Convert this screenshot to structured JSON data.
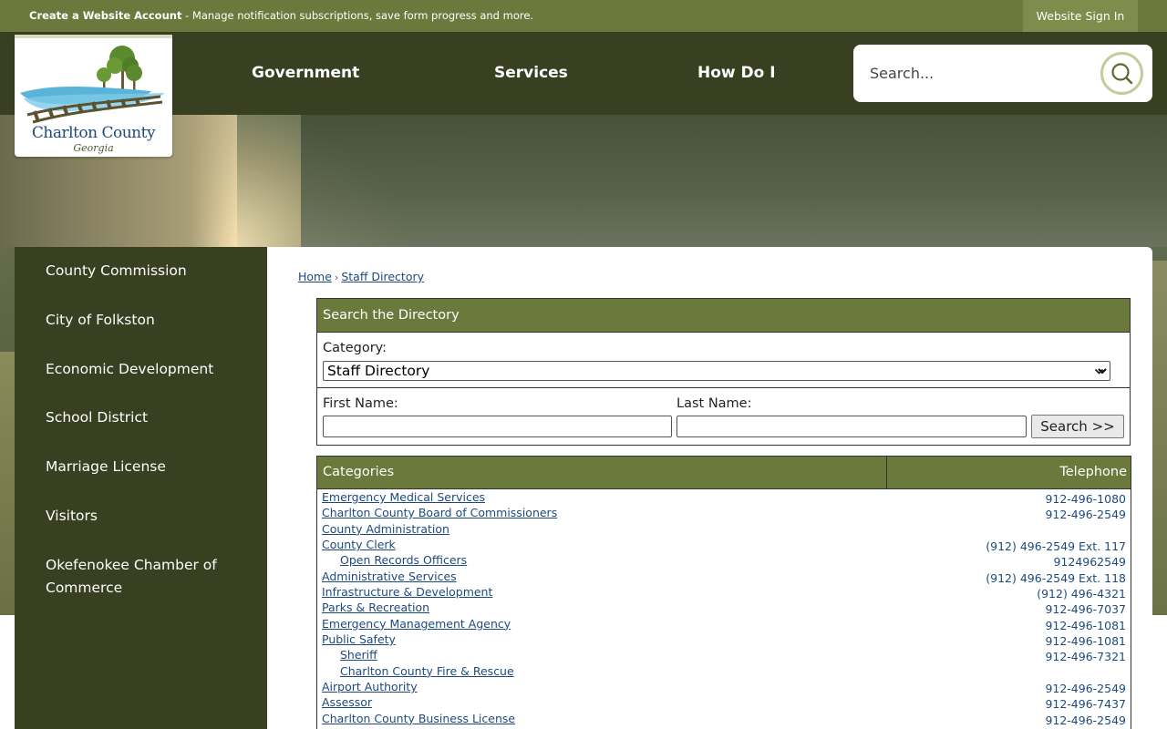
{
  "topbar": {
    "promo_bold": "Create a Website Account",
    "promo_text": " - Manage notification subscriptions, save form progress and more.",
    "signin_label": "Website Sign In"
  },
  "logo": {
    "name": "Charlton County",
    "sub": "Georgia"
  },
  "nav": {
    "items": [
      "Government",
      "Services",
      "How Do I"
    ]
  },
  "search": {
    "placeholder": "Search..."
  },
  "sidebar": {
    "items": [
      "County Commission",
      "City of Folkston",
      "Economic Development",
      "School District",
      "Marriage License",
      "Visitors",
      "Okefenokee Chamber of Commerce"
    ]
  },
  "breadcrumb": {
    "home": "Home",
    "current": "Staff Directory"
  },
  "directory": {
    "title": "Search the Directory",
    "category_label": "Category:",
    "category_value": "Staff Directory",
    "first_name_label": "First Name:",
    "last_name_label": "Last Name:",
    "search_button": "Search >>"
  },
  "categories": {
    "col_name": "Categories",
    "col_phone": "Telephone",
    "rows": [
      {
        "name": "Emergency Medical Services",
        "phone": "912-496-1080",
        "sub": false
      },
      {
        "name": "Charlton County Board of Commissioners",
        "phone": "912-496-2549",
        "sub": false
      },
      {
        "name": "County Administration",
        "phone": "",
        "sub": false
      },
      {
        "name": "County Clerk",
        "phone": "(912) 496-2549 Ext. 117",
        "sub": false
      },
      {
        "name": "Open Records Officers",
        "phone": "9124962549",
        "sub": true
      },
      {
        "name": "Administrative Services",
        "phone": "(912) 496-2549 Ext. 118",
        "sub": false
      },
      {
        "name": "Infrastructure & Development",
        "phone": "(912) 496-4321",
        "sub": false
      },
      {
        "name": "Parks & Recreation",
        "phone": "912-496-7037",
        "sub": false
      },
      {
        "name": "Emergency Management Agency",
        "phone": "912-496-1081",
        "sub": false
      },
      {
        "name": "Public Safety",
        "phone": "912-496-1081",
        "sub": false
      },
      {
        "name": "Sheriff",
        "phone": "912-496-7321",
        "sub": true
      },
      {
        "name": "Charlton County Fire & Rescue",
        "phone": "",
        "sub": true
      },
      {
        "name": "Airport Authority",
        "phone": "912-496-2549",
        "sub": false
      },
      {
        "name": "Assessor",
        "phone": "912-496-7437",
        "sub": false
      },
      {
        "name": "Charlton County Business License",
        "phone": "912-496-2549",
        "sub": false
      }
    ]
  },
  "colors": {
    "olive_bar": "#6b7a3c",
    "dark_olive": "#394022",
    "link_blue": "#1d4a7e"
  }
}
